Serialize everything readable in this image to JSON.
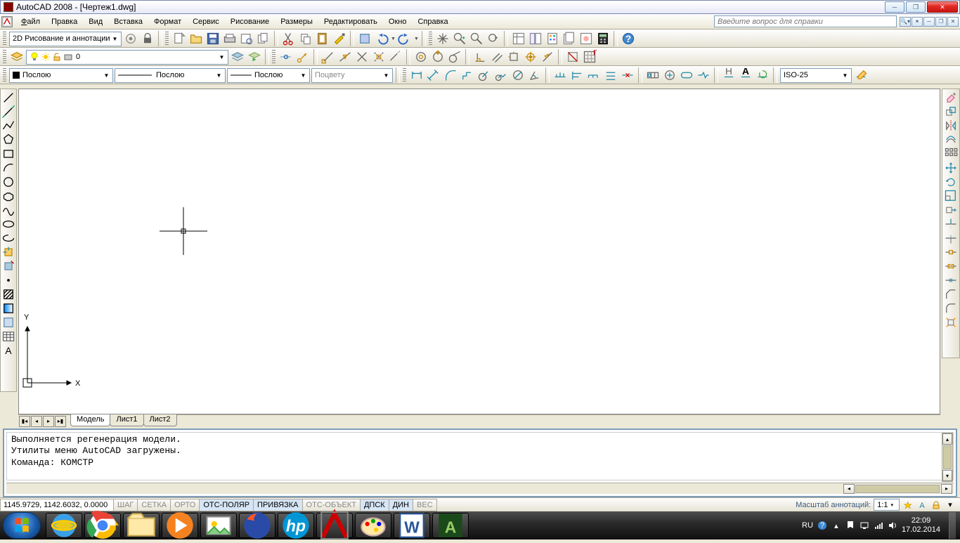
{
  "title": "AutoCAD 2008 - [Чертеж1.dwg]",
  "menu": {
    "file": "Файл",
    "edit": "Правка",
    "view": "Вид",
    "insert": "Вставка",
    "format": "Формат",
    "service": "Сервис",
    "drawing": "Рисование",
    "dimensions": "Размеры",
    "modify": "Редактировать",
    "window": "Окно",
    "help": "Справка",
    "help_placeholder": "Введите вопрос для справки"
  },
  "workspace": {
    "value": "2D Рисование и аннотации"
  },
  "layer": {
    "value": "0"
  },
  "props": {
    "color": "Послою",
    "linetype": "Послою",
    "lineweight": "Послою",
    "bycolor": "Поцвету"
  },
  "dimstyle": {
    "value": "ISO-25"
  },
  "tabs": {
    "model": "Модель",
    "layout1": "Лист1",
    "layout2": "Лист2"
  },
  "command": {
    "line1": "Выполняется регенерация модели.",
    "line2": "Утилиты меню AutoCAD загружены.",
    "line3": "Команда: КОМСТР",
    "prompt": "Команда:"
  },
  "status": {
    "coords": "1145.9729, 1142.6032, 0.0000",
    "snap": "ШАГ",
    "grid": "СЕТКА",
    "ortho": "ОРТО",
    "polar": "ОТС-ПОЛЯР",
    "osnap": "ПРИВЯЗКА",
    "otrack": "ОТС-ОБЪЕКТ",
    "ducs": "ДПСК",
    "dyn": "ДИН",
    "lwt": "ВЕС",
    "annoscale_label": "Масштаб аннотаций:",
    "annoscale_value": "1:1"
  },
  "tray": {
    "lang": "RU",
    "time": "22:09",
    "date": "17.02.2014"
  },
  "colors": {
    "accent": "#7f9db9",
    "panel": "#ece9d8",
    "close": "#e02a24"
  }
}
